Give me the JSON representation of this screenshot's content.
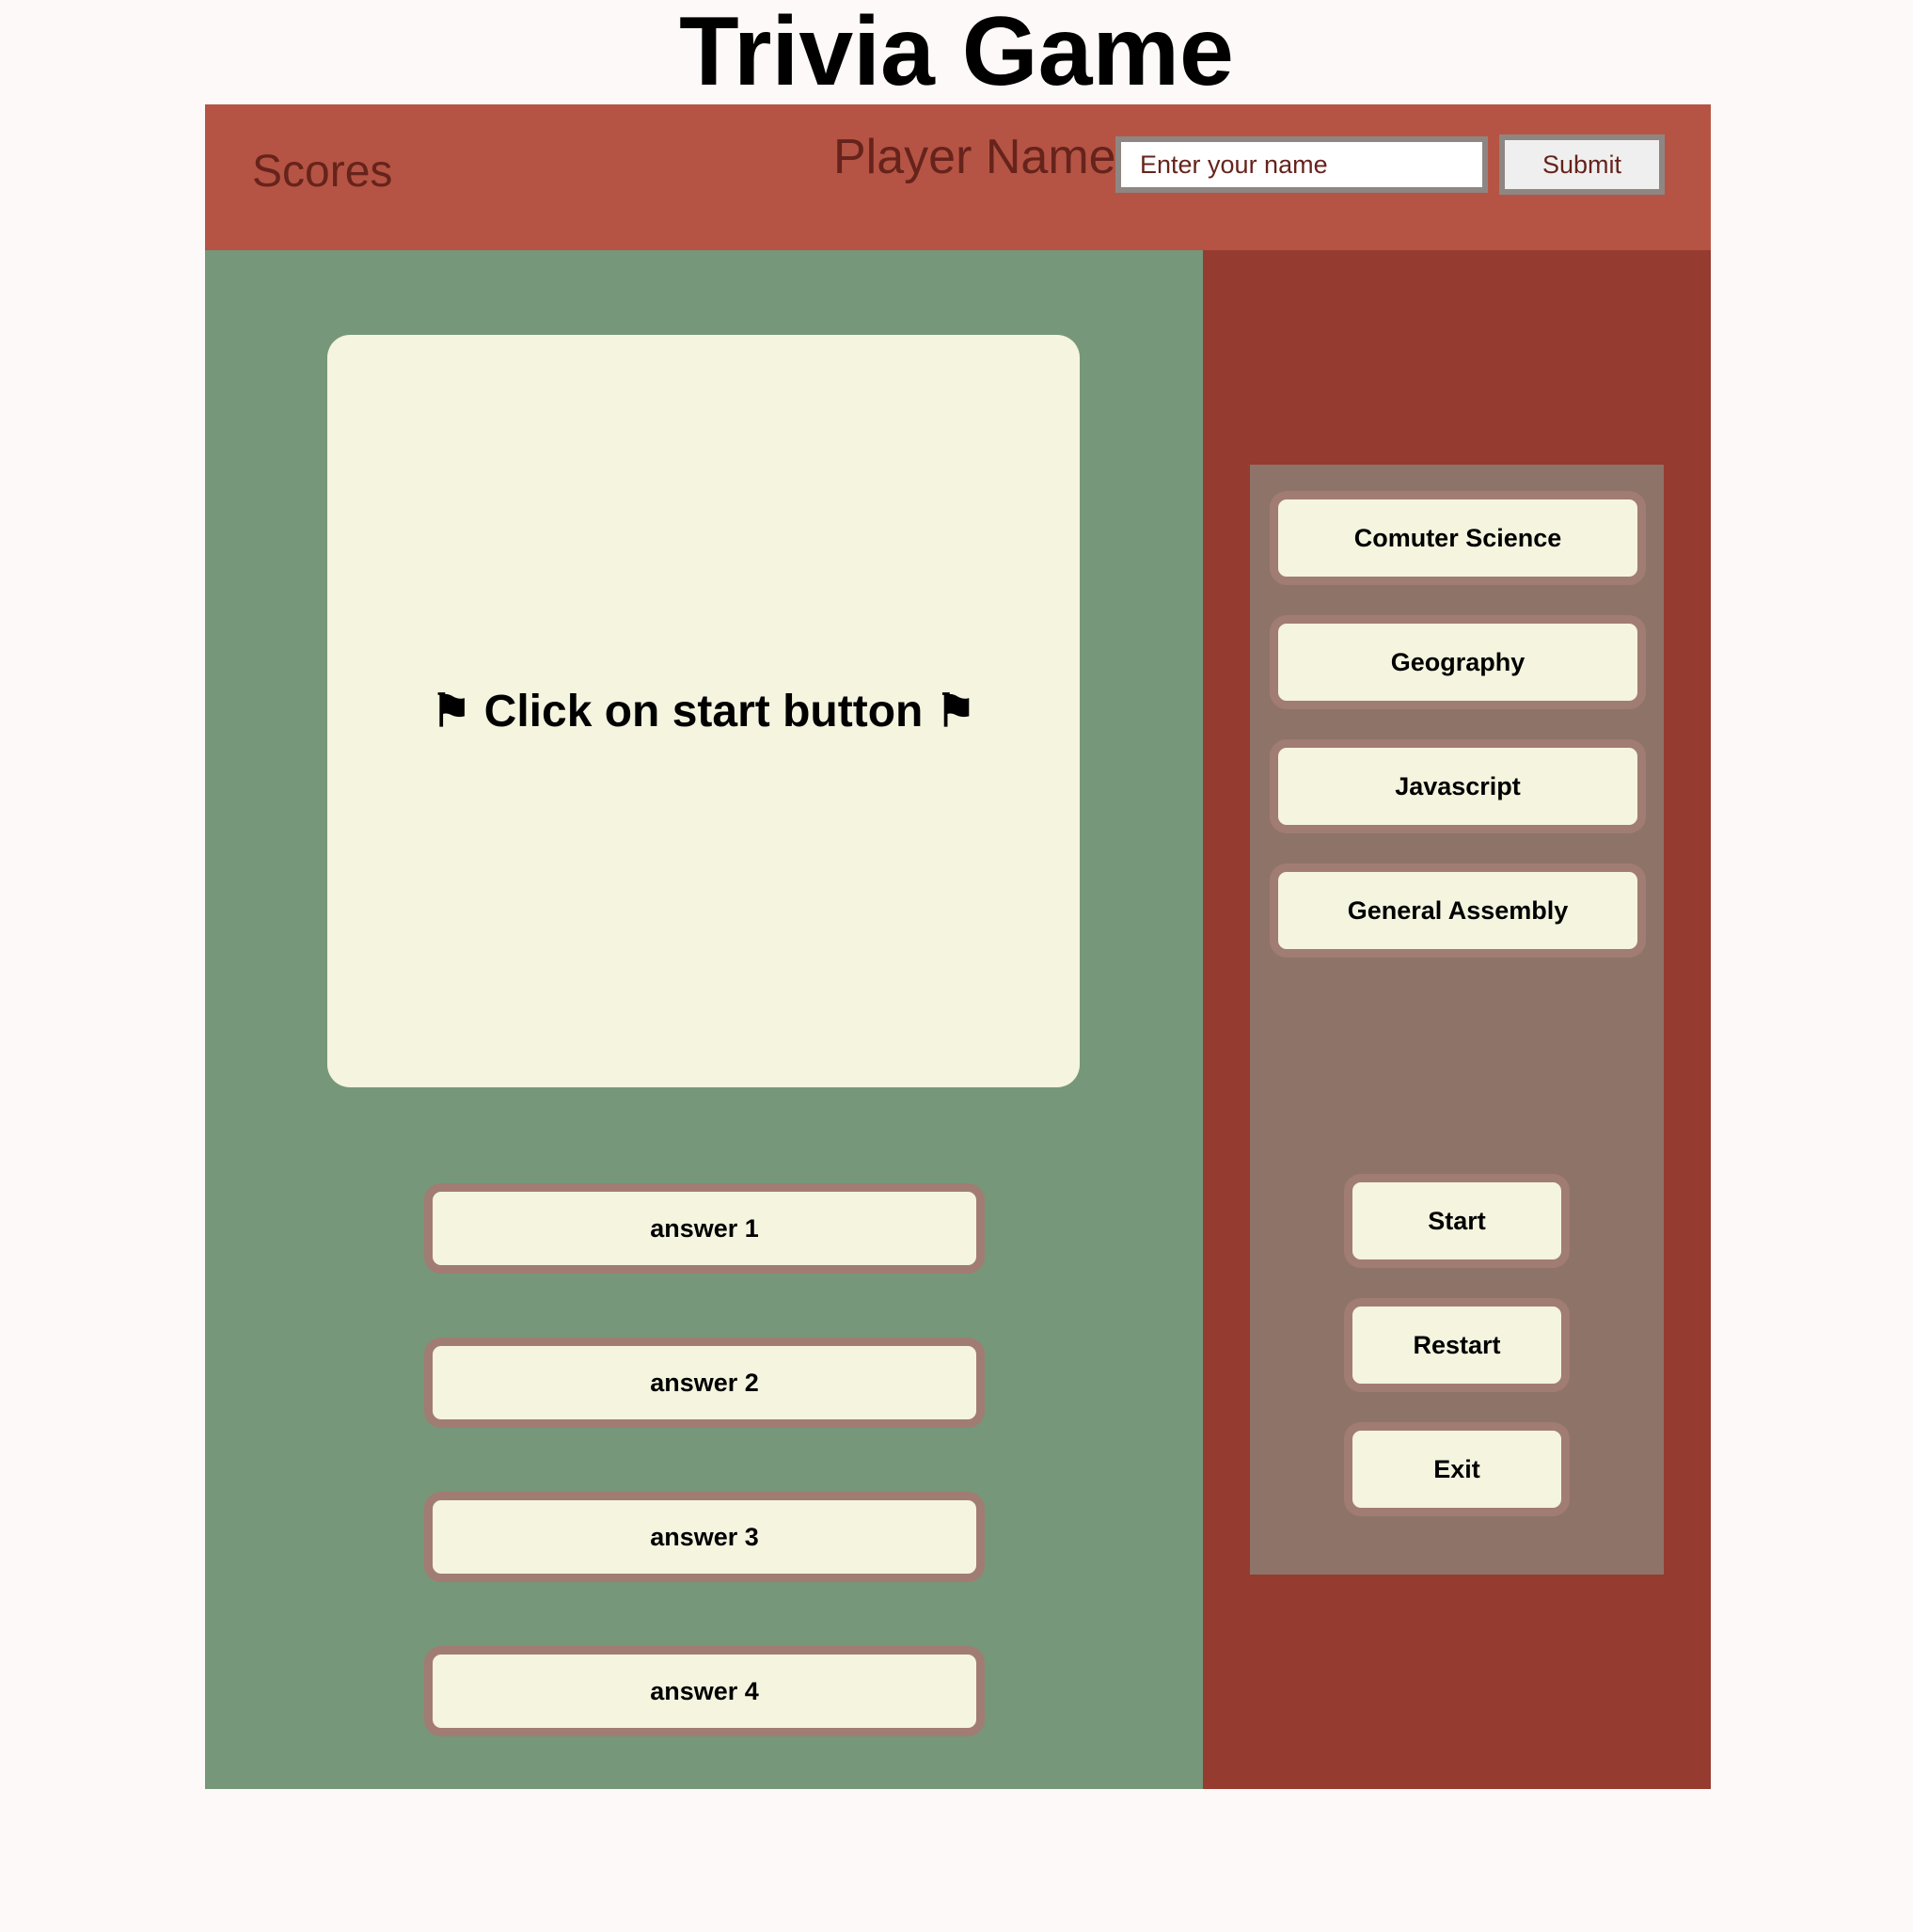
{
  "page": {
    "title": "Trivia Game"
  },
  "header": {
    "scores_label": "Scores",
    "player_name_label": "Player Name:",
    "name_placeholder": "Enter your name",
    "submit_label": "Submit"
  },
  "question": {
    "text": "⚑ Click on start button ⚑"
  },
  "answers": [
    {
      "label": "answer 1"
    },
    {
      "label": "answer 2"
    },
    {
      "label": "answer 3"
    },
    {
      "label": "answer 4"
    }
  ],
  "categories": [
    {
      "label": "Comuter Science"
    },
    {
      "label": "Geography"
    },
    {
      "label": "Javascript"
    },
    {
      "label": "General Assembly"
    }
  ],
  "controls": {
    "start_label": "Start",
    "restart_label": "Restart",
    "exit_label": "Exit"
  },
  "colors": {
    "page_background": "#fdf9f8",
    "header_background": "#b55444",
    "header_text": "#66231b",
    "game_area_background": "#76977a",
    "sidebar_background": "#963b2f",
    "panel_background": "#8e7369",
    "button_background": "#f4f4df",
    "button_border": "#a17c72"
  }
}
